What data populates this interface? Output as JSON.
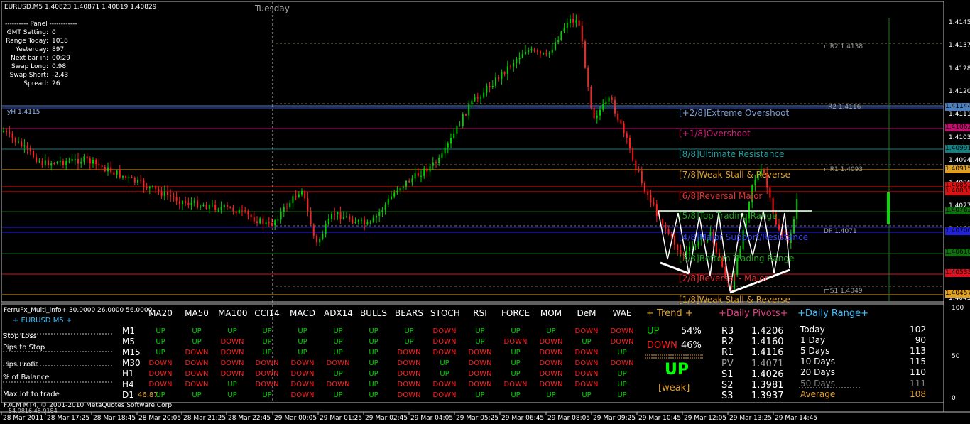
{
  "symbol_header": "EURUSD,M5  1.40823 1.40871 1.40819 1.40829",
  "day_label": "Tuesday",
  "yh_label": "yH 1.4115",
  "colors": {
    "up": "#00d000",
    "down": "#ff2020",
    "bg": "#000000",
    "grid": "#c0c0c0"
  },
  "info_panel": {
    "title": "---------- Panel ------------",
    "rows": [
      {
        "label": "GMT Setting:",
        "value": "0"
      },
      {
        "label": "Range Today:",
        "value": "1018"
      },
      {
        "label": "Yesterday:",
        "value": "897"
      },
      {
        "label": "Next bar in:",
        "value": "00:29"
      },
      {
        "label": "Swap Long:",
        "value": "0.98"
      },
      {
        "label": "Swap Short:",
        "value": "-2.43"
      },
      {
        "label": "Spread:",
        "value": "26"
      }
    ]
  },
  "price_axis": {
    "ticks": [
      "1.41455",
      "1.41370",
      "1.41285",
      "1.41200",
      "1.41115",
      "1.41030",
      "1.40945",
      "1.40860",
      "1.40775",
      "1.40690",
      "1.40605",
      "1.40520",
      "1.40435"
    ],
    "lower_ticks": [
      "100",
      "50",
      "0"
    ],
    "tags": [
      {
        "label": "1.41144",
        "color": "#4a7fbf"
      },
      {
        "label": "1.41062",
        "color": "#c01070"
      },
      {
        "label": "1.40991",
        "color": "#108080"
      },
      {
        "label": "1.40915",
        "color": "#e0a020"
      },
      {
        "label": "1.40852",
        "color": "#e01010"
      },
      {
        "label": "1.40833",
        "color": "#e01010"
      },
      {
        "label": "1.40762",
        "color": "#107010"
      },
      {
        "label": "1.40700",
        "color": "#2020e0"
      },
      {
        "label": "1.40610",
        "color": "#107010"
      },
      {
        "label": "1.40533",
        "color": "#e01020"
      },
      {
        "label": "1.40457",
        "color": "#e0a020"
      }
    ]
  },
  "murrey": [
    {
      "label": "[+2/8]Extreme Overshoot",
      "color": "#7aa0d8"
    },
    {
      "label": "[+1/8]Overshoot",
      "color": "#d0207a"
    },
    {
      "label": "[8/8]Ultimate Resistance",
      "color": "#20a0a0"
    },
    {
      "label": "[7/8]Weak Stall & Reverse",
      "color": "#e0a030"
    },
    {
      "label": "[6/8]Reversal Major",
      "color": "#e03030"
    },
    {
      "label": "[5/8]Top Trading Range",
      "color": "#20a020"
    },
    {
      "label": "[4/8]Major Support/Resistance",
      "color": "#3040ff"
    },
    {
      "label": "[3/8]Bottom Trading Range",
      "color": "#20a020"
    },
    {
      "label": "[2/8]Reversal - Major",
      "color": "#e03030"
    },
    {
      "label": "[1/8]Weak Stall & Reverse",
      "color": "#e0a030"
    }
  ],
  "pivot_labels": {
    "mr2": "mR2 1.4138",
    "r2": "R2 1.4116",
    "mr1": "mR1 1.4093",
    "dp": "DP 1.4071",
    "ms1": "mS1 1.4049"
  },
  "dates": [
    "28 Mar 2011",
    "28 Mar 17:25",
    "28 Mar 18:45",
    "28 Mar 20:05",
    "28 Mar 21:25",
    "28 Mar 22:45",
    "29 Mar 00:05",
    "29 Mar 01:25",
    "29 Mar 02:45",
    "29 Mar 04:05",
    "29 Mar 05:25",
    "29 Mar 06:45",
    "29 Mar 08:05",
    "29 Mar 09:25",
    "29 Mar 10:45",
    "29 Mar 12:05",
    "29 Mar 13:25",
    "29 Mar 14:45"
  ],
  "subwindow": {
    "title": "FerruFx_Multi_info+ 30.0000 26.0000 56.0000",
    "pair": "+ EURUSD M5 +",
    "left_labels": [
      "Stop Loss",
      "Pips to Stop",
      "Pips Profit",
      "% of Balance",
      "Max lot to trade"
    ],
    "pct_value": "46.87",
    "copyright": "FXCM MT4, © 2001-2010 MetaQuotes Software Corp.",
    "bottom_readout": "54.0816 45.9184",
    "indicators": [
      "MA20",
      "MA50",
      "MA100",
      "CCI14",
      "MACD",
      "ADX14",
      "BULLS",
      "BEARS",
      "STOCH",
      "RSI",
      "FORCE",
      "MOM",
      "DeM",
      "WAE"
    ],
    "timeframes": [
      "M1",
      "M5",
      "M15",
      "M30",
      "H1",
      "H4",
      "D1"
    ],
    "signals": [
      [
        "UP",
        "UP",
        "UP",
        "UP",
        "UP",
        "UP",
        "UP",
        "UP",
        "DOWN",
        "UP",
        "UP",
        "UP",
        "DOWN",
        "DOWN"
      ],
      [
        "UP",
        "UP",
        "DOWN",
        "UP",
        "UP",
        "UP",
        "UP",
        "UP",
        "DOWN",
        "UP",
        "DOWN",
        "DOWN",
        "UP",
        "DOWN"
      ],
      [
        "UP",
        "DOWN",
        "DOWN",
        "UP",
        "UP",
        "UP",
        "UP",
        "DOWN",
        "DOWN",
        "DOWN",
        "UP",
        "DOWN",
        "DOWN",
        "UP"
      ],
      [
        "DOWN",
        "DOWN",
        "DOWN",
        "DOWN",
        "DOWN",
        "DOWN",
        "UP",
        "DOWN",
        "UP",
        "DOWN",
        "UP",
        "DOWN",
        "DOWN",
        "DOWN"
      ],
      [
        "DOWN",
        "DOWN",
        "DOWN",
        "DOWN",
        "DOWN",
        "UP",
        "UP",
        "DOWN",
        "UP",
        "DOWN",
        "UP",
        "DOWN",
        "DOWN",
        "UP"
      ],
      [
        "DOWN",
        "DOWN",
        "UP",
        "DOWN",
        "DOWN",
        "DOWN",
        "UP",
        "DOWN",
        "DOWN",
        "DOWN",
        "DOWN",
        "DOWN",
        "DOWN",
        "UP"
      ],
      [
        "UP",
        "UP",
        "UP",
        "UP",
        "DOWN",
        "UP",
        "UP",
        "DOWN",
        "DOWN",
        "UP",
        "UP",
        "UP",
        "UP",
        "UP"
      ]
    ],
    "trend": {
      "title": "+  Trend  +",
      "up_label": "UP",
      "up_pct": "54%",
      "down_label": "DOWN",
      "down_pct": "46%",
      "big": "UP",
      "strength": "[weak]"
    },
    "pivots": {
      "title": "+Daily Pivots+",
      "rows": [
        {
          "n": "R3",
          "v": "1.4206"
        },
        {
          "n": "R2",
          "v": "1.4160"
        },
        {
          "n": "R1",
          "v": "1.4116"
        },
        {
          "n": "PV",
          "v": "1.4071"
        },
        {
          "n": "S1",
          "v": "1.4026"
        },
        {
          "n": "S2",
          "v": "1.3981"
        },
        {
          "n": "S3",
          "v": "1.3937"
        }
      ]
    },
    "range": {
      "title": "+Daily Range+",
      "rows": [
        {
          "n": "Today",
          "v": "102"
        },
        {
          "n": "1 Day",
          "v": "90"
        },
        {
          "n": "5 Days",
          "v": "113"
        },
        {
          "n": "10 Days",
          "v": "115"
        },
        {
          "n": "20 Days",
          "v": "110"
        },
        {
          "n": "50 Days",
          "v": "111"
        },
        {
          "n": "Average",
          "v": "108"
        }
      ]
    }
  }
}
